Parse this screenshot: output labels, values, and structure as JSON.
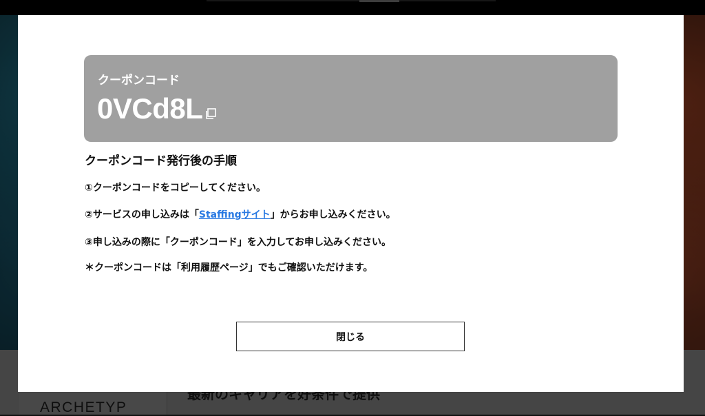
{
  "background": {
    "logo_text": "ARCHETYP",
    "tagline": "最新のキャリアを好条件で提供"
  },
  "modal": {
    "coupon_label": "クーポンコード",
    "coupon_code": "0VCd8L",
    "copy_icon": "copy-icon",
    "section_title": "クーポンコード発行後の手順",
    "step1": "①クーポンコードをコピーしてください。",
    "step2_prefix": "②サービスの申し込みは「",
    "step2_link": "Staffingサイト",
    "step2_suffix": "」からお申し込みください。",
    "step3": "③申し込みの際に「クーポンコード」を入力してお申し込みください。",
    "note": "＊クーポンコードは「利用履歴ページ」でもご確認いただけます。",
    "close_label": "閉じる"
  },
  "colors": {
    "coupon_bg": "#a0a0a0",
    "link": "#2a7ae2"
  }
}
